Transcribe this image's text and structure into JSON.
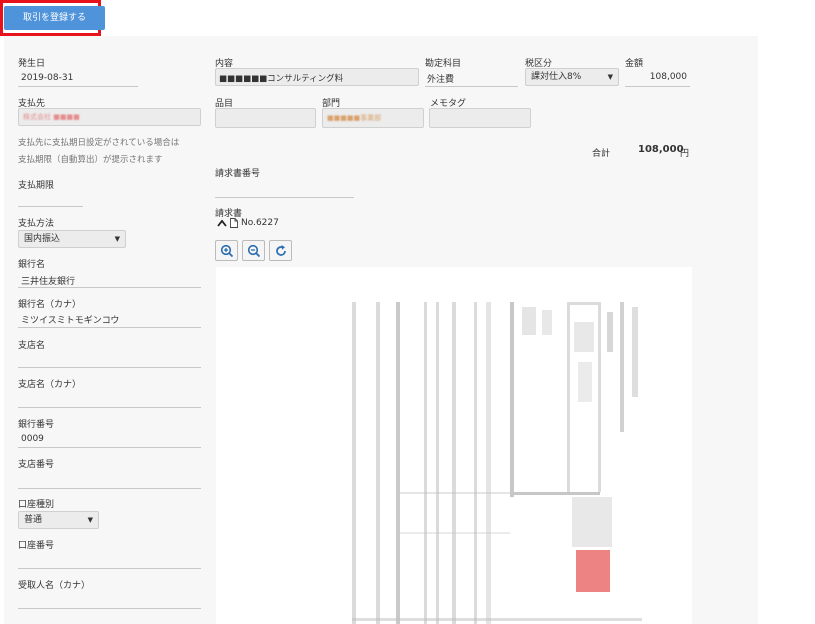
{
  "toolbar": {
    "register_label": "取引を登録する"
  },
  "form": {
    "date_label": "発生日",
    "date_value": "2019-08-31",
    "payee_label": "支払先",
    "payee_value": "株式会社 ■■■■",
    "payee_hint_1": "支払先に支払期日設定がされている場合は",
    "payee_hint_2": "支払期限（自動算出）が提示されます",
    "due_label": "支払期限",
    "due_value": "",
    "method_label": "支払方法",
    "method_value": "国内振込",
    "bank_label": "銀行名",
    "bank_value": "三井住友銀行",
    "bank_kana_label": "銀行名（カナ）",
    "bank_kana_value": "ミツイスミトモギンコウ",
    "branch_label": "支店名",
    "branch_value": "",
    "branch_kana_label": "支店名（カナ）",
    "branch_kana_value": "",
    "bank_code_label": "銀行番号",
    "bank_code_value": "0009",
    "branch_code_label": "支店番号",
    "branch_code_value": "",
    "account_type_label": "口座種別",
    "account_type_value": "普通",
    "account_no_label": "口座番号",
    "account_no_value": "",
    "recipient_label": "受取人名（カナ）",
    "recipient_value": ""
  },
  "line": {
    "content_label": "内容",
    "content_value": "■■■■■■コンサルティング料",
    "account_label": "勘定科目",
    "account_value": "外注費",
    "tax_label": "税区分",
    "tax_value": "課対仕入8%",
    "amount_label": "金額",
    "amount_value": "108,000",
    "item_label": "品目",
    "item_value": "",
    "dept_label": "部門",
    "dept_value": "■■■■■事業部",
    "memo_label": "メモタグ",
    "memo_value": "",
    "total_label": "合計",
    "total_value": "108,000",
    "total_unit": "円"
  },
  "invoice": {
    "number_label": "請求書番号",
    "number_value": "",
    "doc_label": "請求書",
    "doc_name": "No.6227"
  },
  "icons": [
    "zoom-in-icon",
    "zoom-out-icon",
    "rotate-icon",
    "chevron-up-icon",
    "file-icon",
    "chevron-down-icon"
  ],
  "colors": {
    "primary": "#4f94db",
    "highlight": "#e8121c",
    "panel": "#f7f7f7",
    "stamp": "#e85a5a"
  }
}
